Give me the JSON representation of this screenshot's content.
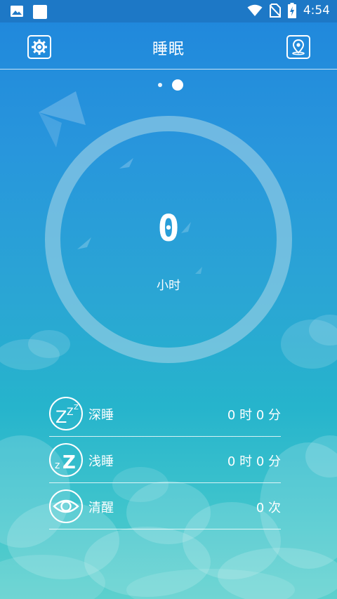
{
  "status_bar": {
    "time": "4:54",
    "left_icons": [
      "image-icon",
      "app-icon"
    ],
    "right_icons": [
      "wifi-icon",
      "no-sim-icon",
      "battery-charging-icon"
    ]
  },
  "header": {
    "title": "睡眠",
    "left_button_icon": "gear-icon",
    "right_button_icon": "location-icon"
  },
  "pager": {
    "total": 2,
    "active": 2
  },
  "ring": {
    "value": "0",
    "unit": "小时"
  },
  "stats": [
    {
      "label": "深睡",
      "value": "0 时 0 分",
      "icon": "deep-sleep-icon"
    },
    {
      "label": "浅睡",
      "value": "0 时 0 分",
      "icon": "light-sleep-icon"
    },
    {
      "label": "清醒",
      "value": "0 次",
      "icon": "eye-icon"
    }
  ],
  "colors": {
    "status_bar": "#1d78c6",
    "background_top": "#1f86dc",
    "background_bottom": "#5dd0cd",
    "text": "#ffffff"
  }
}
